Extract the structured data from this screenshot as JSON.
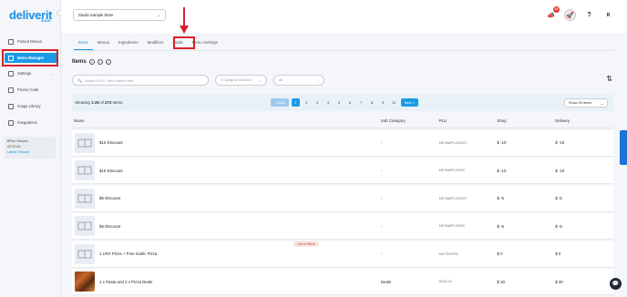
{
  "brand": {
    "logo_text": "deliverit",
    "logo_sub": "SOLID"
  },
  "sidebar": {
    "items": [
      {
        "label": "Pinned Menus",
        "icon": "pin-icon"
      },
      {
        "label": "Menu Manager",
        "icon": "menu-icon"
      },
      {
        "label": "Settings",
        "icon": "gear-icon"
      },
      {
        "label": "Promo Code",
        "icon": "ticket-icon"
      },
      {
        "label": "Image Library",
        "icon": "image-icon"
      },
      {
        "label": "Integrations",
        "icon": "plug-icon"
      }
    ],
    "version": {
      "label": "BPos Version",
      "number": "02.20.61",
      "link": "Latest Version"
    }
  },
  "header": {
    "store": "Studio Sample Store",
    "notification_count": "32",
    "avatar": "R"
  },
  "tabs": [
    "Items",
    "Menus",
    "Ingredients",
    "Modifiers",
    "Deals",
    "Menu Settings"
  ],
  "items_section": {
    "title": "Items",
    "search_placeholder": "Search PLU / Item Name here",
    "category_placeholder": "0 Category selected",
    "type_select": "All"
  },
  "pagination": {
    "showing_prefix": "Showing ",
    "showing_range": "1-25",
    "showing_mid": " of ",
    "showing_total": "273",
    "showing_suffix": " Items.",
    "back": "< Back",
    "pages": [
      "1",
      "2",
      "3",
      "4",
      "5",
      "6",
      "7",
      "8",
      "9",
      "10"
    ],
    "next": "Next >",
    "per_page": "Show 25 Items"
  },
  "table": {
    "headers": {
      "name": "Name",
      "sub": "Sub Category",
      "plu": "PLU",
      "shop": "Shop",
      "delivery": "Delivery"
    },
    "rows": [
      {
        "name": "$10 Discount",
        "sub": "-",
        "plu": "MKTAMPL2DS1S",
        "shop": "$ -10",
        "delivery": "$ -10",
        "badge": ""
      },
      {
        "name": "$10 Discount",
        "sub": "-",
        "plu": "MKTAMPL2NDS",
        "shop": "$ -10",
        "delivery": "$ -10",
        "badge": ""
      },
      {
        "name": "$5 Discount",
        "sub": "-",
        "plu": "MKTAMPL2DS1S",
        "shop": "$ -5",
        "delivery": "$ -5",
        "badge": ""
      },
      {
        "name": "$5 Discount",
        "sub": "-",
        "plu": "MKTAMPL2NDS",
        "shop": "$ -5",
        "delivery": "$ -5",
        "badge": ""
      },
      {
        "name": "1 LRG Pizza + Free Garlic Pizza",
        "sub": "-",
        "plu": "MKTSHOPA",
        "shop": "$ 0",
        "delivery": "$ 0",
        "badge": "Out of Stock"
      },
      {
        "name": "1 x Pasta and 2 x Pizza Deals",
        "sub": "Deals",
        "plu": "DEAL10",
        "shop": "$ 20",
        "delivery": "$ 20",
        "badge": ""
      }
    ]
  },
  "colors": {
    "accent": "#1b9be6",
    "annotation": "#d8212a"
  }
}
